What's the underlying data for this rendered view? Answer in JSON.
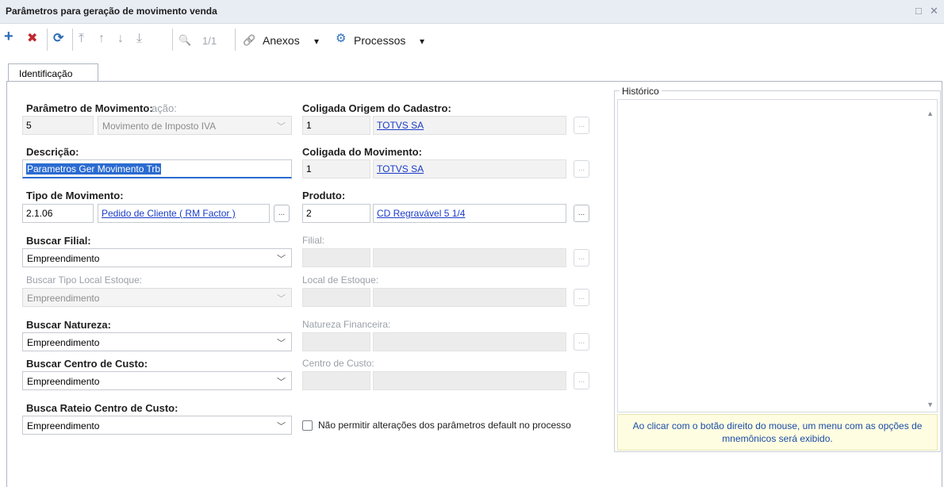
{
  "window": {
    "title": "Parâmetros para geração de movimento venda",
    "maximize_glyph": "□",
    "close_glyph": "✕"
  },
  "toolbar": {
    "add_glyph": "+",
    "delete_glyph": "✖",
    "refresh_glyph": "⟳",
    "first_glyph": "⤒",
    "prev_glyph": "↑",
    "next_glyph": "↓",
    "last_glyph": "⤓",
    "search_glyph": "🔍",
    "page_indicator": "1/1",
    "attachments_label": "Anexos",
    "processes_label": "Processos",
    "dropdown_glyph": "▾",
    "attachment_icon_glyph": "🔗",
    "gear_icon_glyph": "⚙"
  },
  "tabs": [
    {
      "label": "Identificação",
      "active": true
    }
  ],
  "form": {
    "param_label": "Parâmetro de Movimento:",
    "param_label_overlap": "ação:",
    "param_code": "5",
    "param_type": "Movimento de Imposto IVA",
    "description_label": "Descrição:",
    "description_value": "Parametros Ger Movimento Trb",
    "tipo_label": "Tipo de Movimento:",
    "tipo_code": "2.1.06",
    "tipo_name": "Pedido de Cliente  ( RM Factor )",
    "buscar_filial_label": "Buscar Filial:",
    "buscar_filial_value": "Empreendimento",
    "buscar_tipo_local_label": "Buscar Tipo Local Estoque:",
    "buscar_tipo_local_value": "Empreendimento",
    "buscar_natureza_label": "Buscar Natureza:",
    "buscar_natureza_value": "Empreendimento",
    "buscar_centro_label": "Buscar Centro de Custo:",
    "buscar_centro_value": "Empreendimento",
    "busca_rateio_label": "Busca Rateio Centro de Custo:",
    "busca_rateio_value": "Empreendimento",
    "coligada_origem_label": "Coligada Origem do Cadastro:",
    "coligada_origem_code": "1",
    "coligada_origem_name": "TOTVS SA",
    "coligada_mov_label": "Coligada do Movimento:",
    "coligada_mov_code": "1",
    "coligada_mov_name": "TOTVS SA",
    "produto_label": "Produto:",
    "produto_code": "2",
    "produto_name": "CD Regravável 5 1/4",
    "filial_label": "Filial:",
    "local_estoque_label": "Local de Estoque:",
    "natureza_fin_label": "Natureza Financeira:",
    "centro_custo_label": "Centro de Custo:",
    "lookup_button_label": "...",
    "checkbox_label": "Não permitir alterações dos parâmetros default no processo",
    "checkbox_checked": false
  },
  "historico": {
    "title": "Histórico",
    "tip": "Ao clicar com o botão direito do mouse, um menu com as opções de mnemônicos será exibido."
  }
}
